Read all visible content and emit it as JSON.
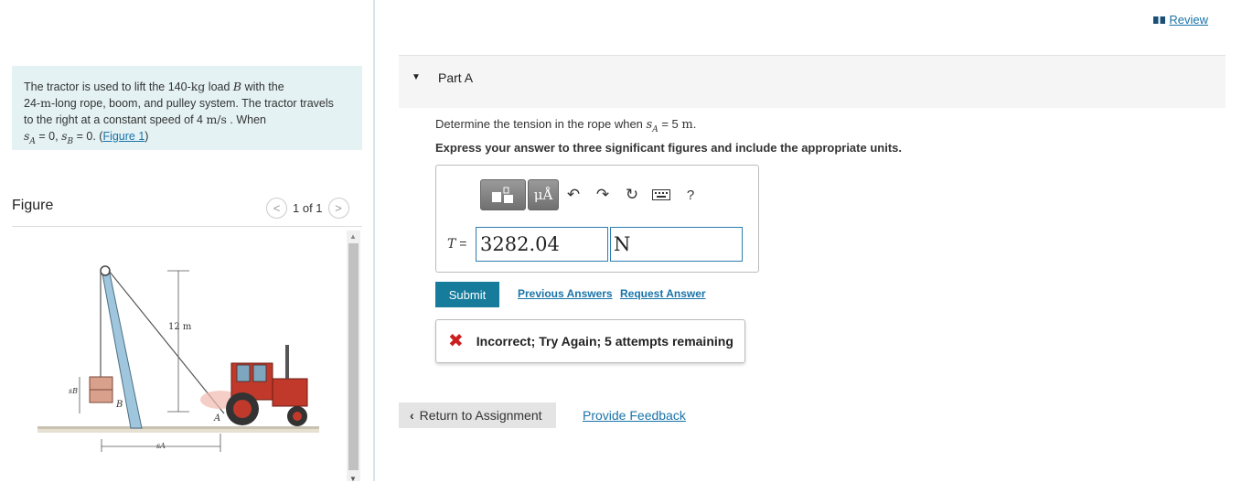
{
  "problem": {
    "line1_pre": "The tractor is used to lift the 140-",
    "mass_unit": "kg",
    "line1_mid": " load ",
    "load_var": "B",
    "line1_post": " with the",
    "line2_num": "24-",
    "length_unit": "m",
    "line2_post": "-long rope, boom, and pulley system. The tractor travels",
    "line3_pre": "to the right at a constant speed of 4 ",
    "speed_unit": "m/s",
    "line3_post": " . When",
    "cond_sa": "s",
    "cond_sa_sub": "A",
    "cond_mid": " = 0, ",
    "cond_sb": "s",
    "cond_sb_sub": "B",
    "cond_end": " = 0. (",
    "figure_link": "Figure 1",
    "close_paren": ")"
  },
  "figure": {
    "title": "Figure",
    "pager": "1 of 1",
    "prev_glyph": "<",
    "next_glyph": ">",
    "label_height": "12 m",
    "label_sb": "sB",
    "label_b": "B",
    "label_a": "A",
    "label_sa": "sA"
  },
  "header": {
    "review_icon": "book-icon",
    "review_label": "Review"
  },
  "part": {
    "label": "Part A"
  },
  "question": {
    "text_pre": "Determine the tension in the rope when ",
    "var": "s",
    "var_sub": "A",
    "text_post": " = 5 ",
    "unit": "m",
    "period": "."
  },
  "instruction": "Express your answer to three significant figures and include the appropriate units.",
  "toolbar": {
    "units_label": "μÅ",
    "help_label": "?"
  },
  "answer": {
    "var": "T",
    "eq": " =",
    "value": "3282.04",
    "unit": "N"
  },
  "actions": {
    "submit": "Submit",
    "previous_answers": "Previous Answers",
    "request_answer": "Request Answer"
  },
  "feedback": {
    "text": "Incorrect; Try Again; 5 attempts remaining"
  },
  "footer": {
    "return_label": "Return to Assignment",
    "provide_feedback": "Provide Feedback"
  },
  "colors": {
    "accent": "#177b9c",
    "link": "#1a73a8",
    "problem_bg": "#e4f2f4",
    "error": "#cc1f1f",
    "tractor": "#c0392b"
  }
}
